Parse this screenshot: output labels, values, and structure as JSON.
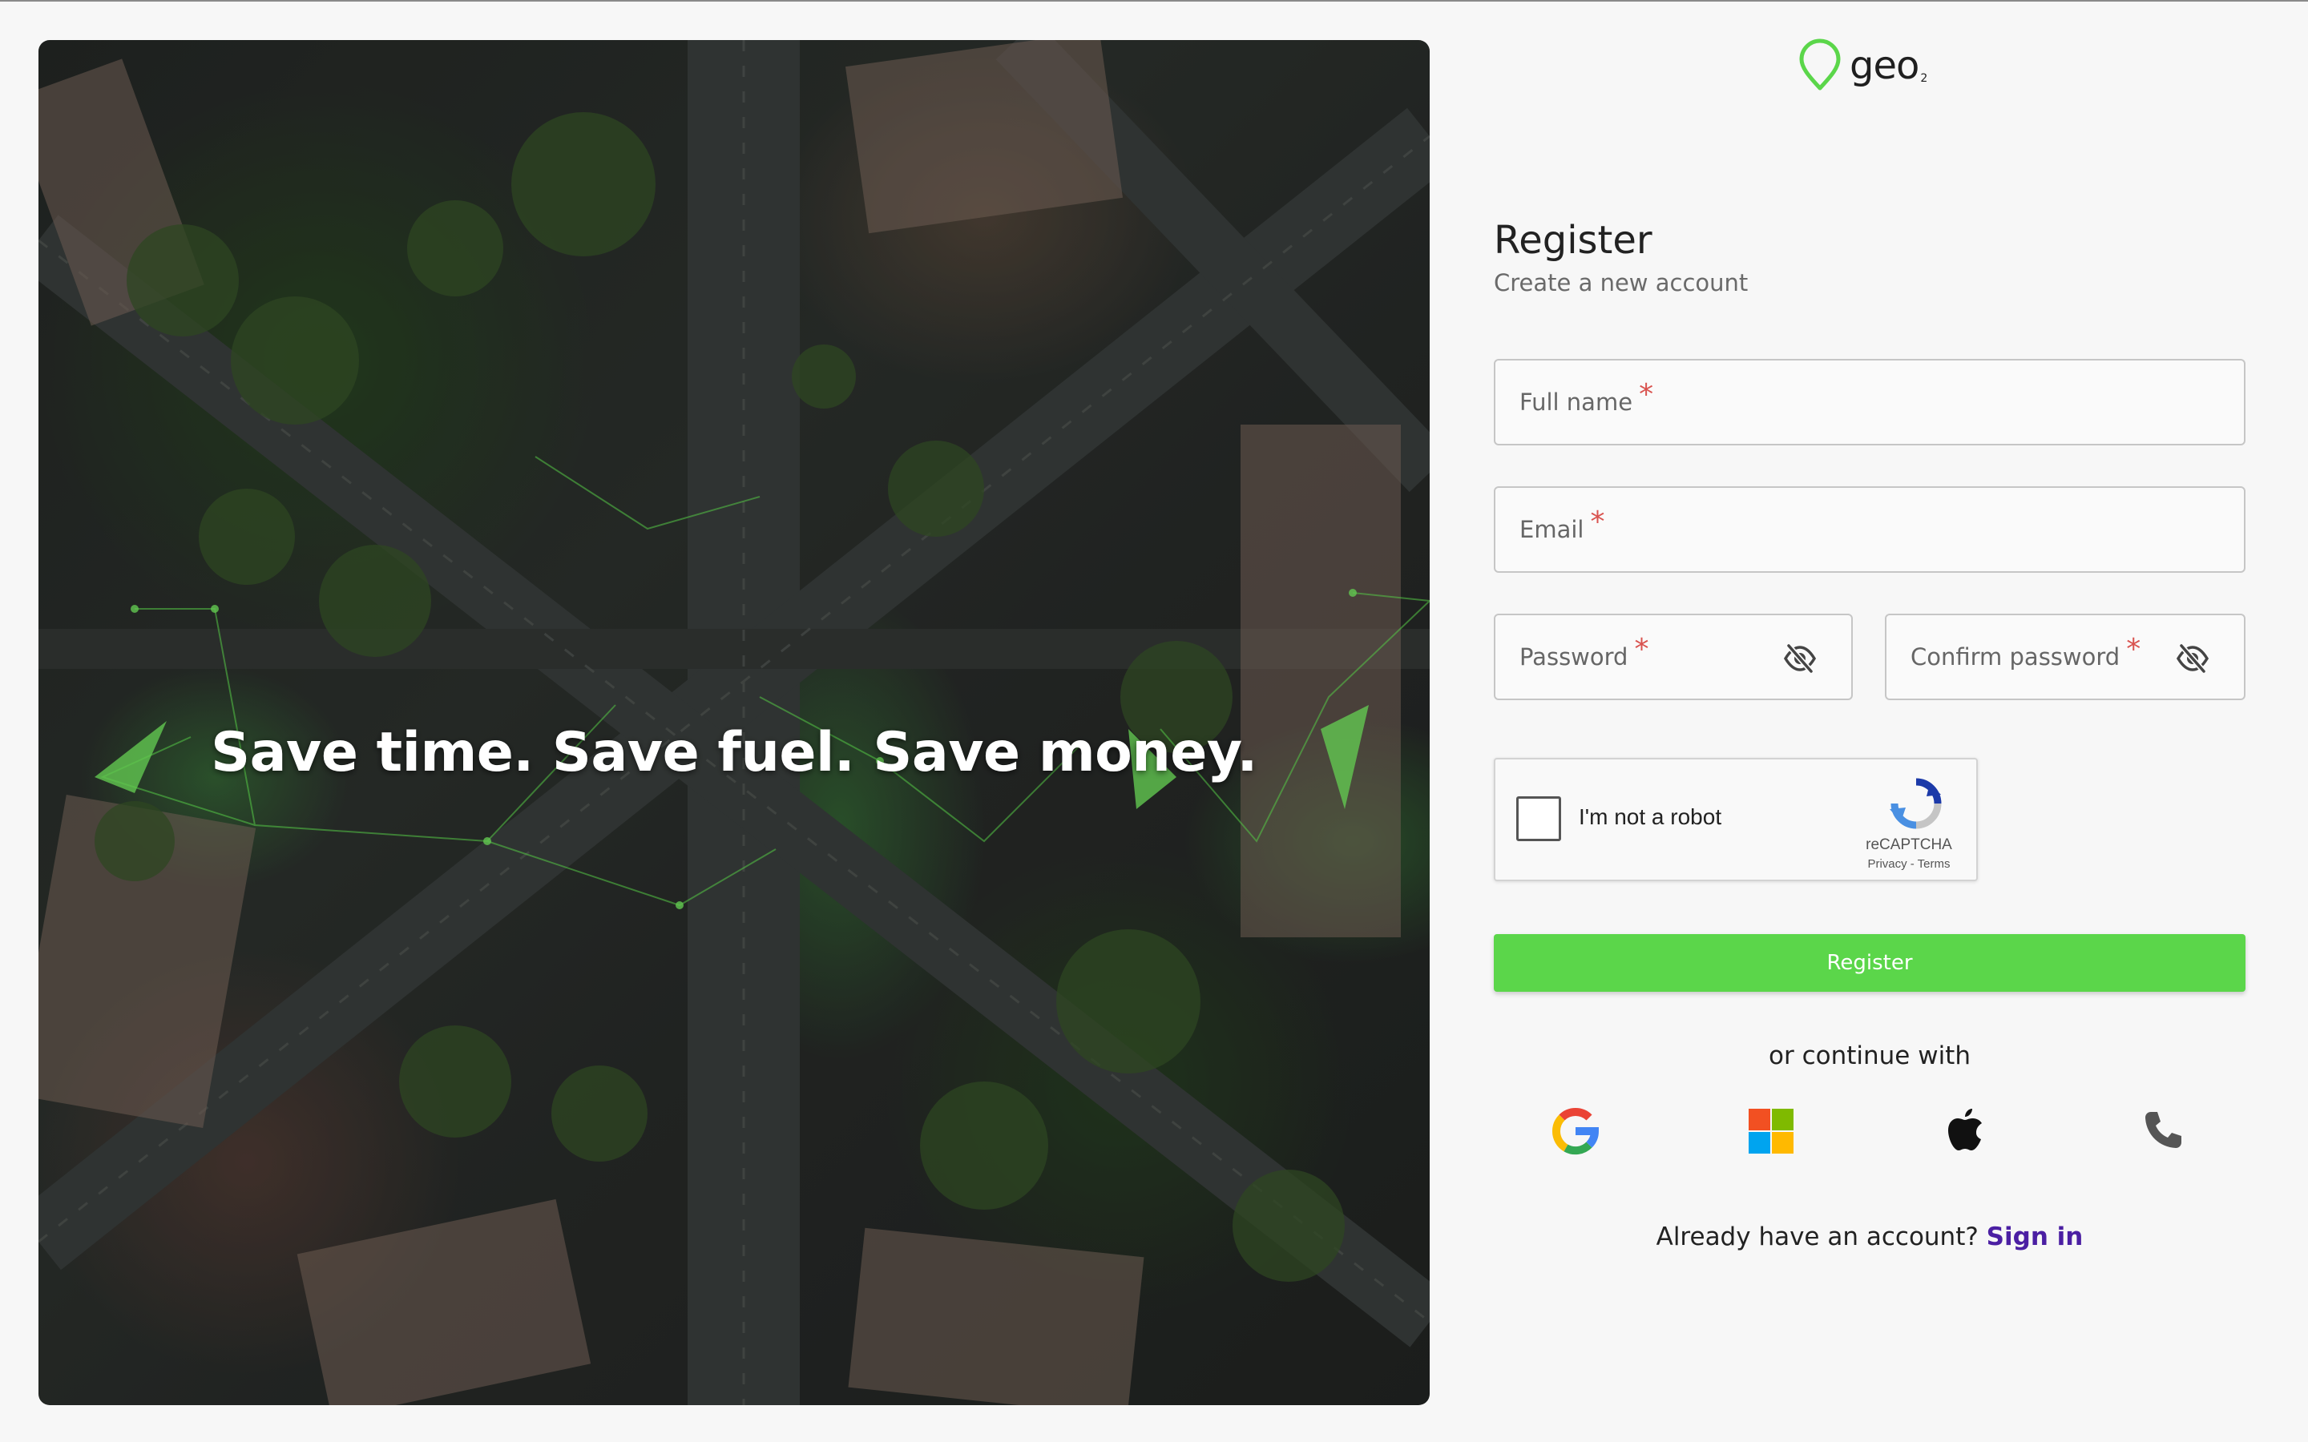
{
  "brand": {
    "name": "geo",
    "suffix": "2",
    "accent": "#5bd64a"
  },
  "hero": {
    "headline": "Save time. Save fuel. Save money."
  },
  "form": {
    "title": "Register",
    "subtitle": "Create a new account",
    "fields": {
      "full_name": {
        "label": "Full name",
        "required": "*"
      },
      "email": {
        "label": "Email",
        "required": "*"
      },
      "password": {
        "label": "Password",
        "required": "*",
        "icon": "eye-off-icon"
      },
      "confirm_password": {
        "label": "Confirm password",
        "required": "*",
        "icon": "eye-off-icon"
      }
    },
    "captcha": {
      "label": "I'm not a robot",
      "brand": "reCAPTCHA",
      "terms": "Privacy - Terms"
    },
    "submit_label": "Register",
    "submit_color": "#5bd64a"
  },
  "social": {
    "divider_text": "or continue with",
    "providers": [
      "google-icon",
      "microsoft-icon",
      "apple-icon",
      "phone-icon"
    ]
  },
  "signin": {
    "prompt": "Already have an account?",
    "link": "Sign in",
    "link_color": "#4b1fa3"
  }
}
